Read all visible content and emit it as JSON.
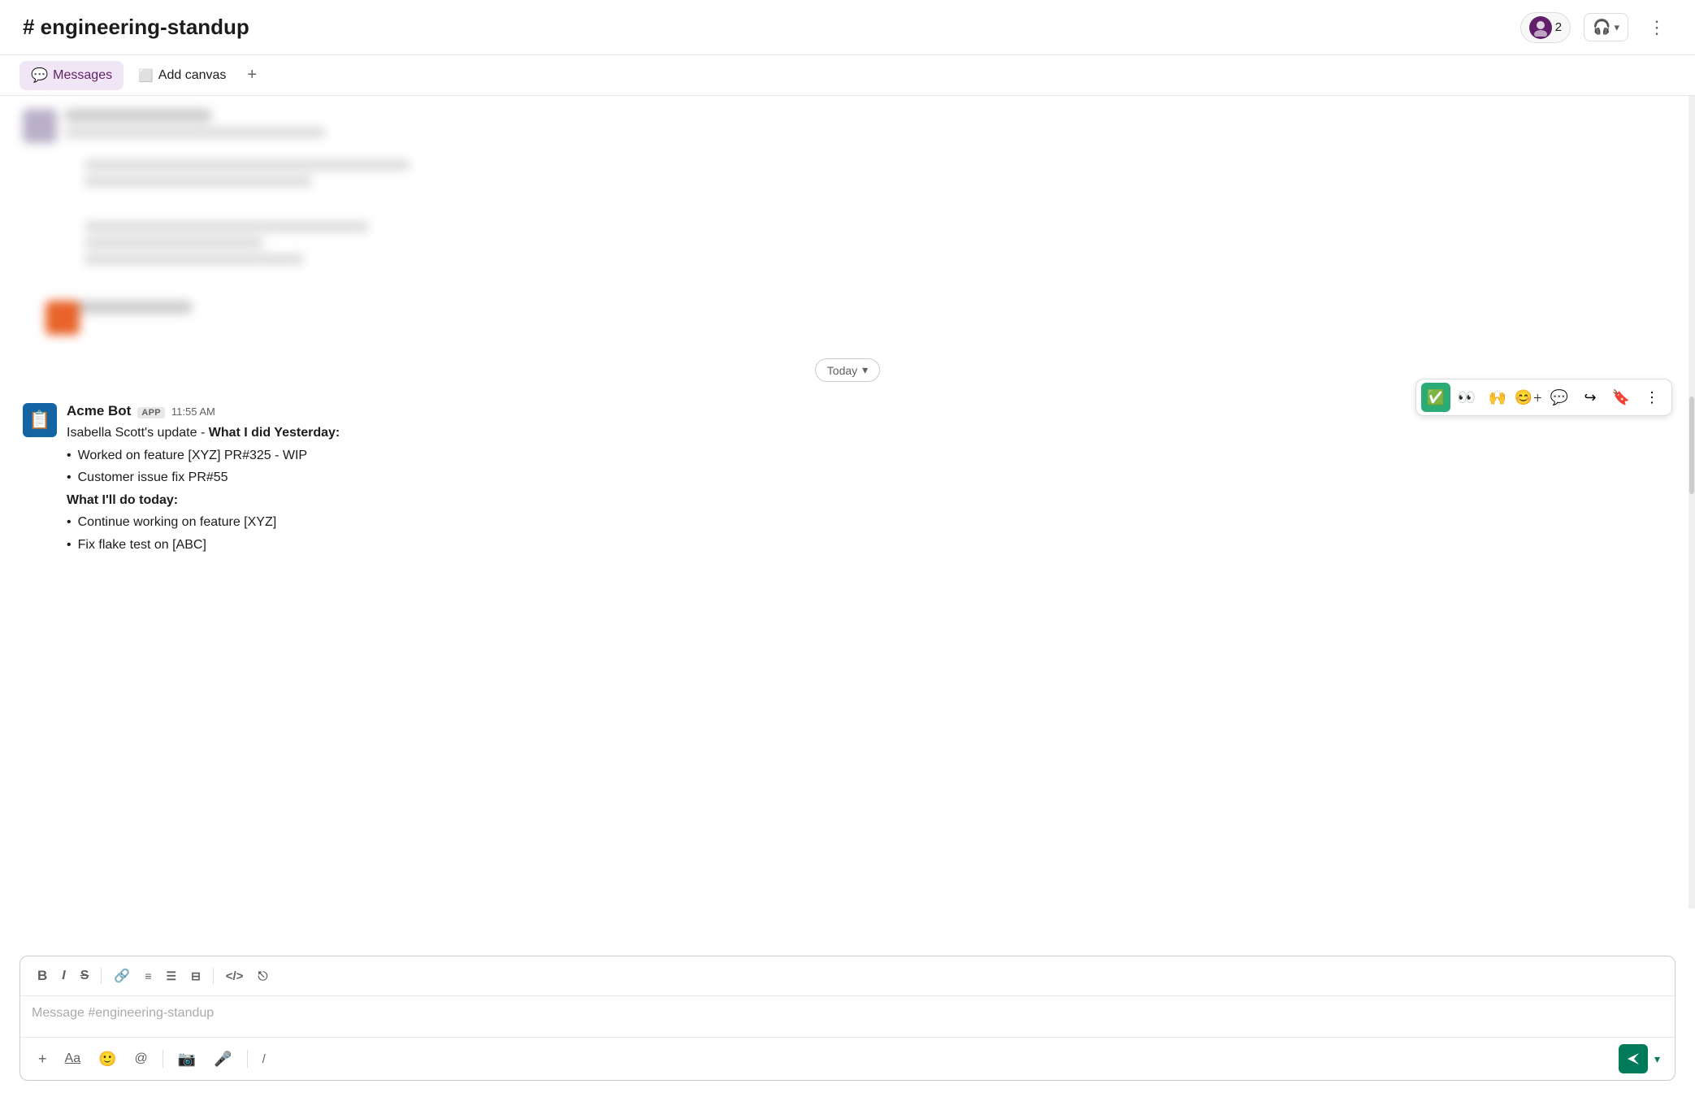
{
  "header": {
    "channel_name": "# engineering-standup",
    "member_count": "2",
    "more_icon": "⋮"
  },
  "tabs": [
    {
      "id": "messages",
      "label": "Messages",
      "active": true
    },
    {
      "id": "add-canvas",
      "label": "Add canvas"
    }
  ],
  "divider": {
    "label": "Today",
    "chevron": "▾"
  },
  "message": {
    "sender": "Acme Bot",
    "badge": "APP",
    "timestamp": "11:55 AM",
    "intro": "Isabella Scott's update - ",
    "section1_title": "What I did Yesterday:",
    "bullets1": [
      "Worked on feature [XYZ] PR#325 - WIP",
      "Customer issue fix PR#55"
    ],
    "section2_title": "What I'll do today:",
    "bullets2": [
      "Continue working on feature [XYZ]",
      "Fix flake test on [ABC]"
    ]
  },
  "composer": {
    "placeholder": "Message #engineering-standup",
    "format_buttons": [
      "B",
      "I",
      "S"
    ],
    "toolbar_icons": [
      "link",
      "ordered-list",
      "unordered-list",
      "indent",
      "code",
      "sketch"
    ],
    "footer_icons": [
      "plus",
      "font",
      "emoji",
      "mention",
      "divider",
      "video",
      "microphone",
      "divider2",
      "slash"
    ]
  },
  "actions": {
    "check": "✅",
    "eyes": "👀",
    "clap": "🙌",
    "add_reaction": "😊",
    "comment": "💬",
    "forward": "↪",
    "bookmark": "🔖",
    "more": "⋮"
  }
}
